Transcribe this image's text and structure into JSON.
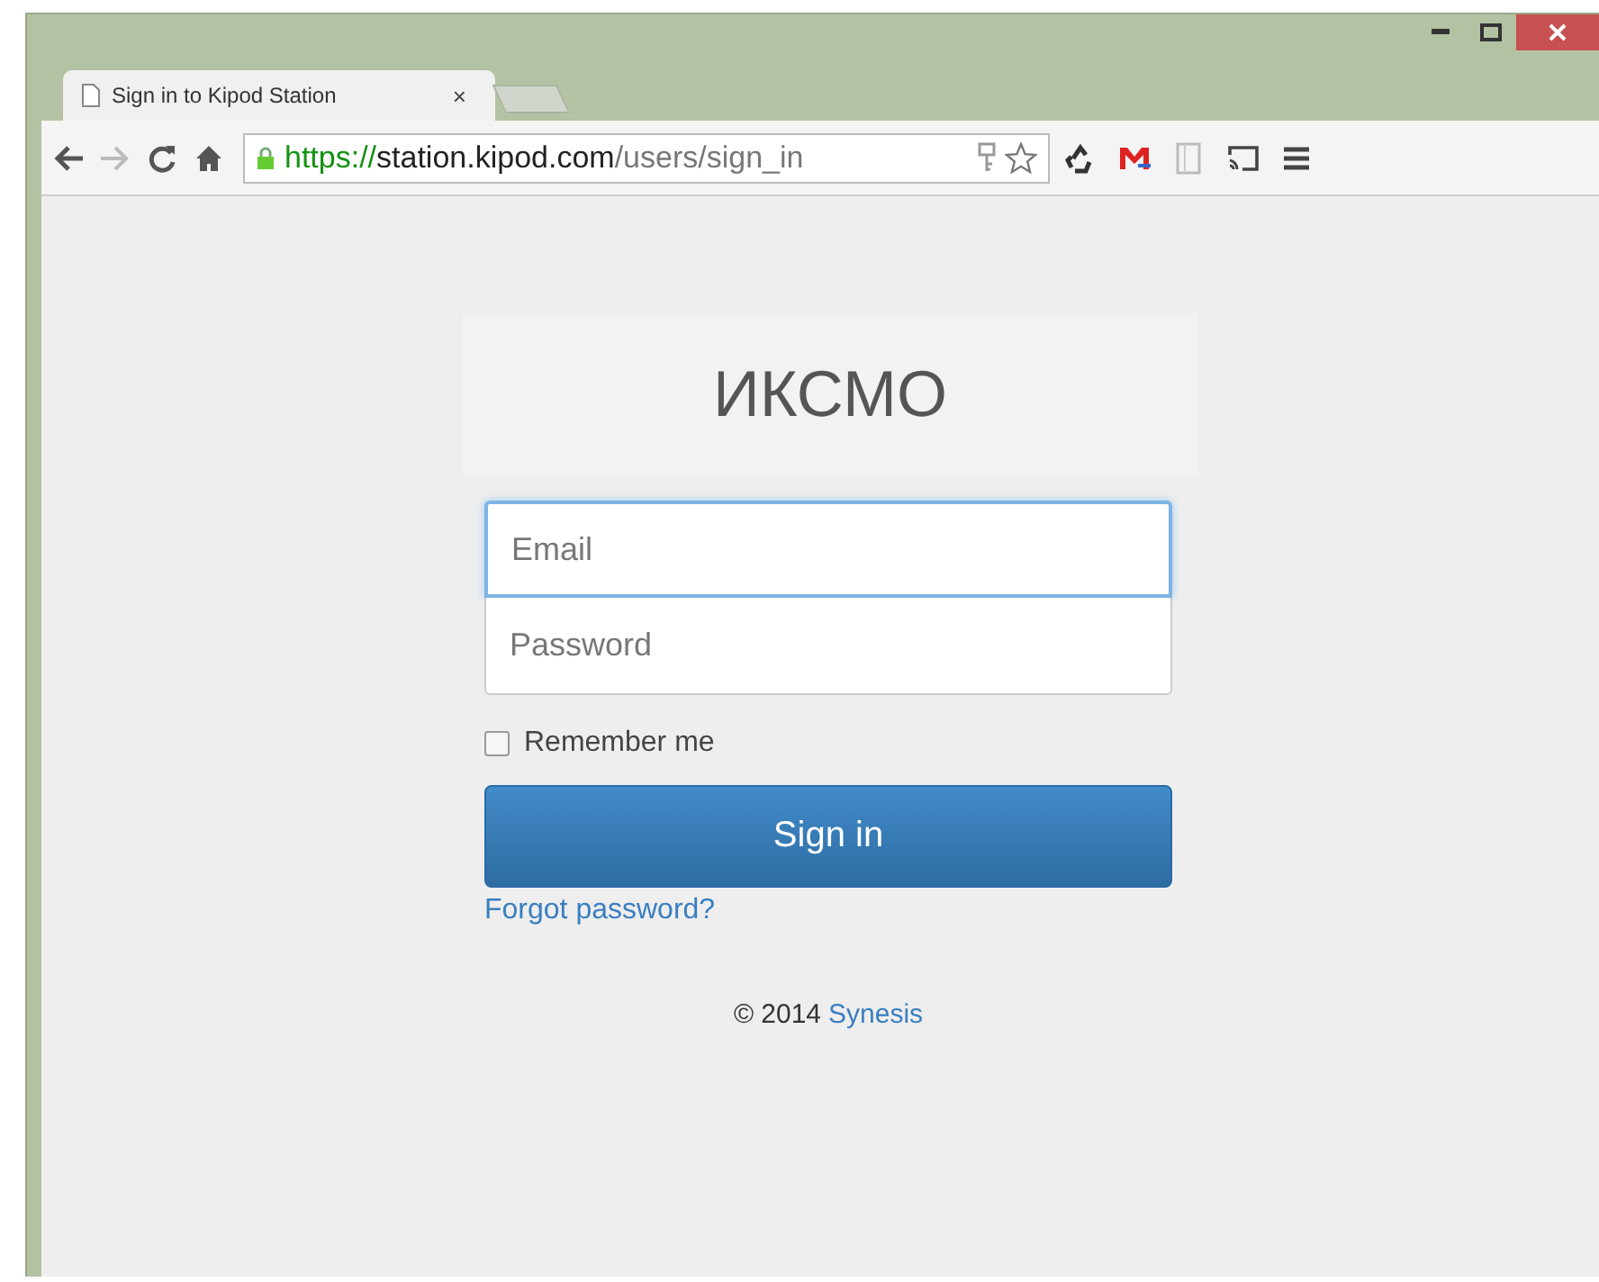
{
  "window": {
    "tab": {
      "title": "Sign in to Kipod Station",
      "close": "×",
      "selected": true
    },
    "address": {
      "scheme": "https://",
      "host": "station.kipod.com",
      "path": "/users/sign_in"
    }
  },
  "page": {
    "logo": "ИКСМО",
    "fields": [
      {
        "placeholder": "Email",
        "focused": true
      },
      {
        "placeholder": "Password",
        "focused": false
      }
    ],
    "remember": {
      "label": "Remember me",
      "checked": false
    },
    "button": "Sign in",
    "forgot": "Forgot password?",
    "footer": {
      "copyright": "© 2014",
      "link": "Synesis"
    }
  }
}
